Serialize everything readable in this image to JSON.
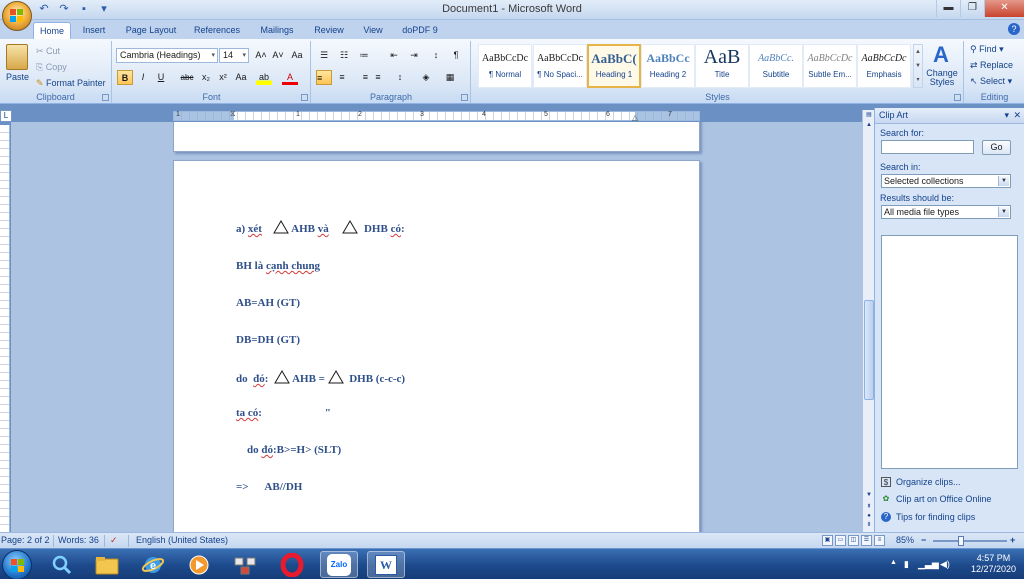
{
  "window": {
    "title": "Document1 - Microsoft Word",
    "minimize": "▬",
    "restore": "❐",
    "close": "✕"
  },
  "qat": {
    "undo": "↶",
    "redo": "↷",
    "save": "▪",
    "customize": "▾"
  },
  "tabs": [
    "Home",
    "Insert",
    "Page Layout",
    "References",
    "Mailings",
    "Review",
    "View",
    "doPDF 9"
  ],
  "active_tab": "Home",
  "help": "?",
  "ribbon": {
    "clipboard": {
      "label": "Clipboard",
      "paste": "Paste",
      "cut": "Cut",
      "copy": "Copy",
      "format_painter": "Format Painter"
    },
    "font": {
      "label": "Font",
      "font_name": "Cambria (Headings)",
      "font_size": "14",
      "grow": "A˄",
      "shrink": "A˅",
      "clear": "Aa",
      "bold": "B",
      "italic": "I",
      "underline": "U",
      "strike": "abc",
      "subscript": "x₂",
      "superscript": "x²",
      "change_case": "Aa",
      "highlight": "ab",
      "font_color": "A"
    },
    "paragraph": {
      "label": "Paragraph",
      "bullets": "☰",
      "numbering": "☷",
      "multilevel": "≔",
      "decrease_indent": "⇤",
      "increase_indent": "⇥",
      "sort": "↕",
      "pilcrow": "¶",
      "align_left": "≡",
      "center": "≡",
      "align_right": "≡",
      "justify": "≡",
      "line_spacing": "↕",
      "shading": "◈",
      "borders": "▦"
    },
    "styles": {
      "label": "Styles",
      "items": [
        {
          "sample": "AaBbCcDc",
          "name": "¶ Normal"
        },
        {
          "sample": "AaBbCcDc",
          "name": "¶ No Spaci..."
        },
        {
          "sample": "AaBbC(",
          "name": "Heading 1"
        },
        {
          "sample": "AaBbCc",
          "name": "Heading 2"
        },
        {
          "sample": "AaB",
          "name": "Title"
        },
        {
          "sample": "AaBbCc.",
          "name": "Subtitle"
        },
        {
          "sample": "AaBbCcDc",
          "name": "Subtle Em..."
        },
        {
          "sample": "AaBbCcDc",
          "name": "Emphasis"
        }
      ],
      "change_styles": "Change Styles"
    },
    "editing": {
      "label": "Editing",
      "find": "Find",
      "replace": "Replace",
      "select": "Select"
    }
  },
  "ruler": {
    "corner": "L",
    "numbers": [
      "1",
      "1",
      "2",
      "3",
      "4",
      "5",
      "6",
      "7"
    ]
  },
  "document": {
    "lines": [
      {
        "parts": [
          "a)",
          "xét",
          "AHB",
          "và",
          "DHB",
          "có",
          ":"
        ]
      },
      {
        "text_a": "BH là",
        "text_b": "cạnh chung"
      },
      {
        "text": "AB=AH  (GT)"
      },
      {
        "text": "DB=DH  (GT)"
      },
      {
        "a": "do",
        "b": "đó",
        "c": ":",
        "d": "AHB =",
        "e": "DHB (c-c-c)"
      },
      {
        "a": "ta có",
        "b": ":",
        "c": "\""
      },
      {
        "a": "do",
        "b": "đó",
        "c": ":B>=H>  (SLT)"
      },
      {
        "text": "=>      AB//DH"
      }
    ]
  },
  "taskpane": {
    "title": "Clip Art",
    "search_for": "Search for:",
    "search_value": "",
    "go": "Go",
    "search_in": "Search in:",
    "search_in_value": "Selected collections",
    "results_should_be": "Results should be:",
    "results_value": "All media file types",
    "links": [
      "Organize clips...",
      "Clip art on Office Online",
      "Tips for finding clips"
    ]
  },
  "statusbar": {
    "page": "Page: 2 of 2",
    "words": "Words: 36",
    "language": "English (United States)",
    "zoom": "85%",
    "zoom_minus": "−",
    "zoom_plus": "+"
  },
  "taskbar": {
    "apps": [
      "search",
      "explorer",
      "internet-explorer",
      "media-player",
      "network-app",
      "opera",
      "zalo",
      "word"
    ],
    "zalo_label": "Zalo",
    "word_label": "W",
    "time": "4:57 PM",
    "date": "12/27/2020"
  },
  "colors": {
    "doc_text": "#2f4f8a",
    "ribbon_text": "#15428b",
    "taskbar": "#1d4a8c"
  }
}
